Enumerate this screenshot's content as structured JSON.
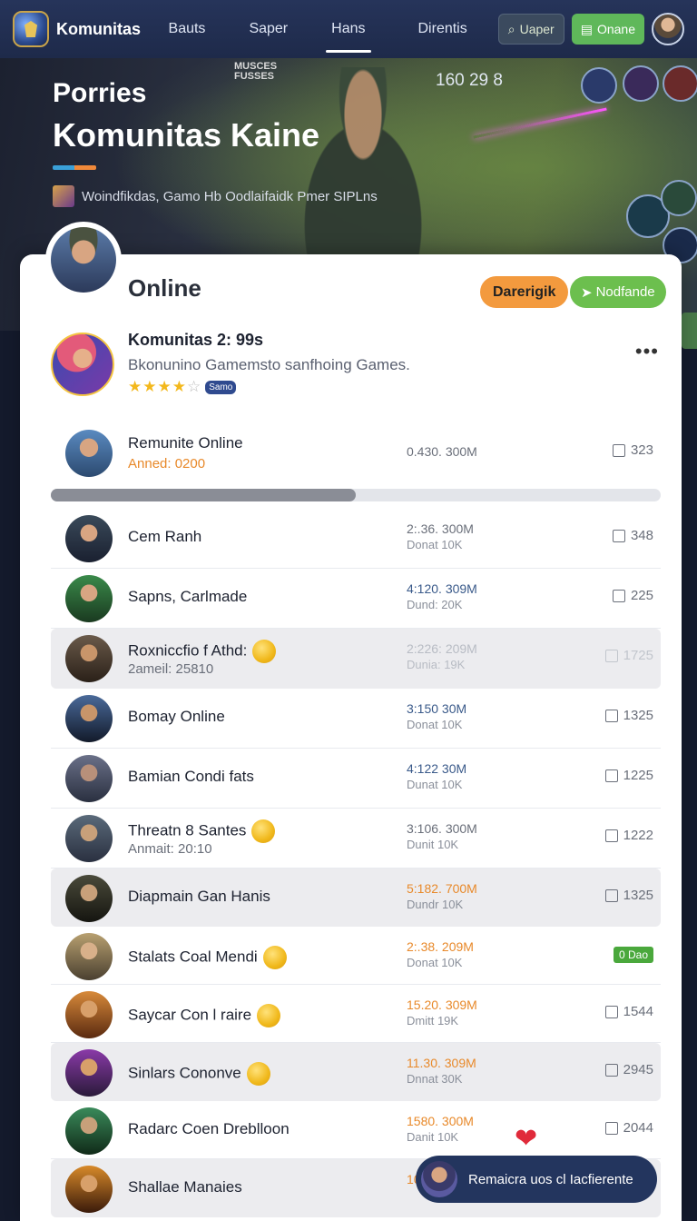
{
  "nav": {
    "logo": "Komunitas",
    "links": [
      "Bauts",
      "Saper",
      "Hans",
      "Direntis"
    ],
    "active_index": 2,
    "login_label": "Uaper",
    "online_label": "Onane"
  },
  "hero": {
    "overlay": "MUSCES\nFUSSES",
    "score": "160 29 8",
    "subtitle": "Porries",
    "title": "Komunitas Kaine",
    "tagline": "Woindfikdas, Gamo Hb Oodlaifaidk Pmer SIPLns"
  },
  "card": {
    "heading": "Online",
    "btn_primary": "Darerigik",
    "btn_secondary": "Nodfande",
    "feature": {
      "title": "Komunitas 2: 99s",
      "desc": "Bkonunino Gamemsto sanfhoing Games.",
      "rating": 3.5,
      "badge": "Samo"
    },
    "top_row": {
      "name": "Remunite Online",
      "sub": "Anned: 0200",
      "stat": "0.430. 300M",
      "likes": "323"
    },
    "progress": 0.5,
    "rows": [
      {
        "name": "Cem Ranh",
        "sub": "",
        "stat1": "2:.36. 300M",
        "stat2": "Donat 10K",
        "likes": "348"
      },
      {
        "name": "Sapns, Carlmade",
        "sub": "",
        "stat1": "4:120. 309M",
        "stat2": "Dund: 20K",
        "likes": "225"
      },
      {
        "name": "Roxniccfio f Athd:",
        "sub": "2ameil: 25810",
        "stat1": "2:226: 209M",
        "stat2": "Dunia: 19K",
        "likes": "1725"
      },
      {
        "name": "Bomay Online",
        "sub": "",
        "stat1": "3:150 30M",
        "stat2": "Donat 10K",
        "likes": "1325"
      },
      {
        "name": "Bamian Condi fats",
        "sub": "",
        "stat1": "4:122 30M",
        "stat2": "Dunat 10K",
        "likes": "1225"
      },
      {
        "name": "Threatn 8 Santes",
        "sub": "Anmait: 20:10",
        "stat1": "3:106. 300M",
        "stat2": "Dunit 10K",
        "likes": "1222"
      },
      {
        "name": "Diapmain Gan Hanis",
        "sub": "",
        "stat1": "5:182. 700M",
        "stat2": "Dundr 10K",
        "likes": "1325"
      },
      {
        "name": "Stalats Coal Mendi",
        "sub": "",
        "stat1": "2:.38. 209M",
        "stat2": "Donat 10K",
        "likes": "0 Dao"
      },
      {
        "name": "Saycar Con l raire",
        "sub": "",
        "stat1": "15.20. 309M",
        "stat2": "Dmitt 19K",
        "likes": "1544"
      },
      {
        "name": "Sinlars Cononve",
        "sub": "",
        "stat1": "11.30. 309M",
        "stat2": "Dnnat 30K",
        "likes": "2945"
      },
      {
        "name": "Radarc Coen Dreblloon",
        "sub": "",
        "stat1": "1580. 300M",
        "stat2": "Danit 10K",
        "likes": "2044"
      },
      {
        "name": "Shallae Manaies",
        "sub": "",
        "stat1": "10",
        "stat2": "",
        "likes": ""
      }
    ]
  },
  "toast": {
    "text": "Remaicra uos cl Iacfierente"
  },
  "colors": {
    "accent_orange": "#f39a3e",
    "accent_green": "#6cbf4e",
    "nav_bg": "#1e2a4a"
  }
}
